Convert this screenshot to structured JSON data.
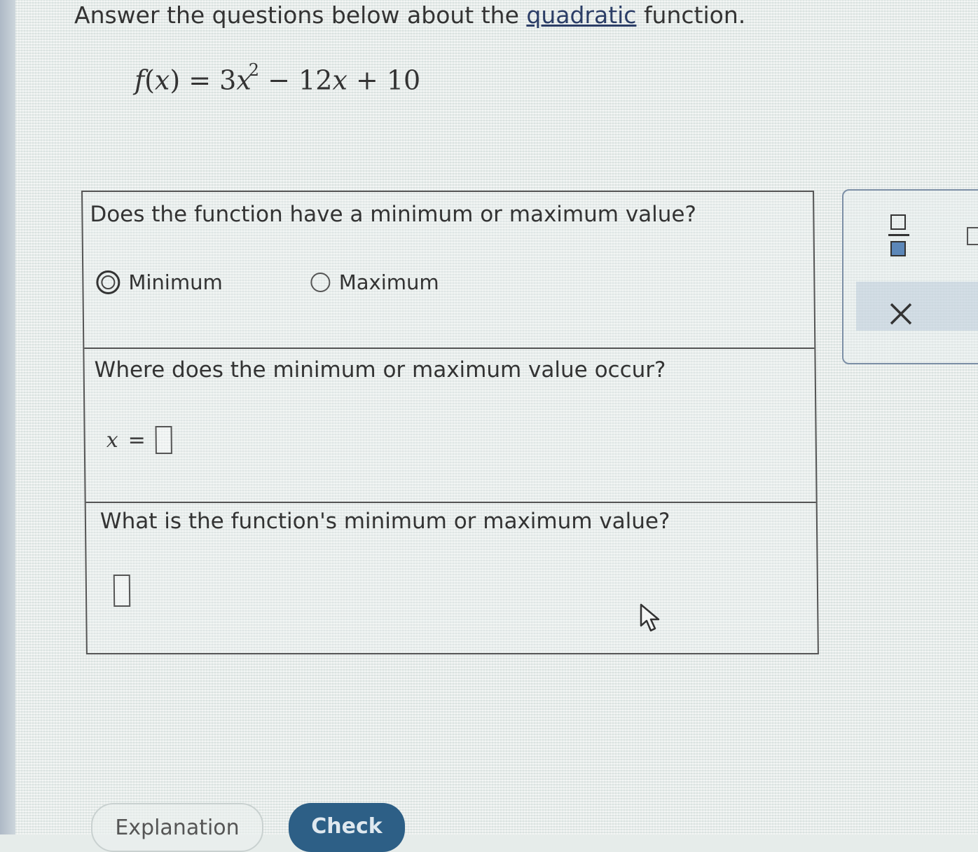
{
  "header": {
    "text_before": "Answer the questions below about the ",
    "link": "quadratic",
    "text_after": " function."
  },
  "formula": {
    "fname": "f",
    "open": "(",
    "var": "x",
    "close": ")",
    "equals": " = 3",
    "x2": "x",
    "exponent": "2",
    "rest": " − 12",
    "x1": "x",
    "tail": " + 10"
  },
  "question1": {
    "prompt": "Does the function have a minimum or maximum value?",
    "options": [
      {
        "label": "Minimum",
        "selected": true
      },
      {
        "label": "Maximum",
        "selected": false
      }
    ]
  },
  "question2": {
    "prompt": "Where does the minimum or maximum value occur?",
    "variable": "x",
    "equals": "=",
    "value": ""
  },
  "question3": {
    "prompt": "What is the function's minimum or maximum value?",
    "value": ""
  },
  "toolbar": {
    "fraction_icon": "fraction-icon",
    "close_icon": "close-icon",
    "accent": "#5c87b8"
  },
  "buttons": {
    "explanation": "Explanation",
    "check": "Check",
    "check_color": "#2d5f86"
  }
}
